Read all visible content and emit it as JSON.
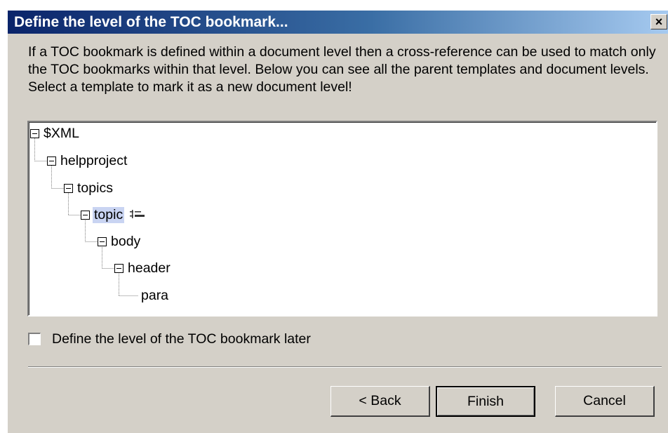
{
  "dialog": {
    "title": "Define the level of the TOC bookmark...",
    "close_glyph": "×",
    "intro_text": "If a TOC bookmark is defined within a document level then a cross-reference can be used to match only the TOC bookmarks within that level. Below you can see all the parent templates and document levels. Select a template to mark it as a new document level!"
  },
  "tree": {
    "nodes": [
      {
        "label": "$XML",
        "expanded": true
      },
      {
        "label": "helpproject",
        "expanded": true
      },
      {
        "label": "topics",
        "expanded": true
      },
      {
        "label": "topic",
        "expanded": true,
        "selected": true,
        "icon": "toc-bookmark-icon"
      },
      {
        "label": "body",
        "expanded": true
      },
      {
        "label": "header",
        "expanded": true
      },
      {
        "label": "para",
        "expanded": false
      }
    ]
  },
  "options": {
    "define_later_label": "Define the level of the TOC bookmark later",
    "define_later_checked": false
  },
  "buttons": {
    "back": "< Back",
    "finish": "Finish",
    "cancel": "Cancel"
  },
  "colors": {
    "title_gradient_start": "#0a246a",
    "title_gradient_end": "#a6caf0",
    "dialog_face": "#d4d0c8",
    "selection": "#c9d4f2"
  }
}
